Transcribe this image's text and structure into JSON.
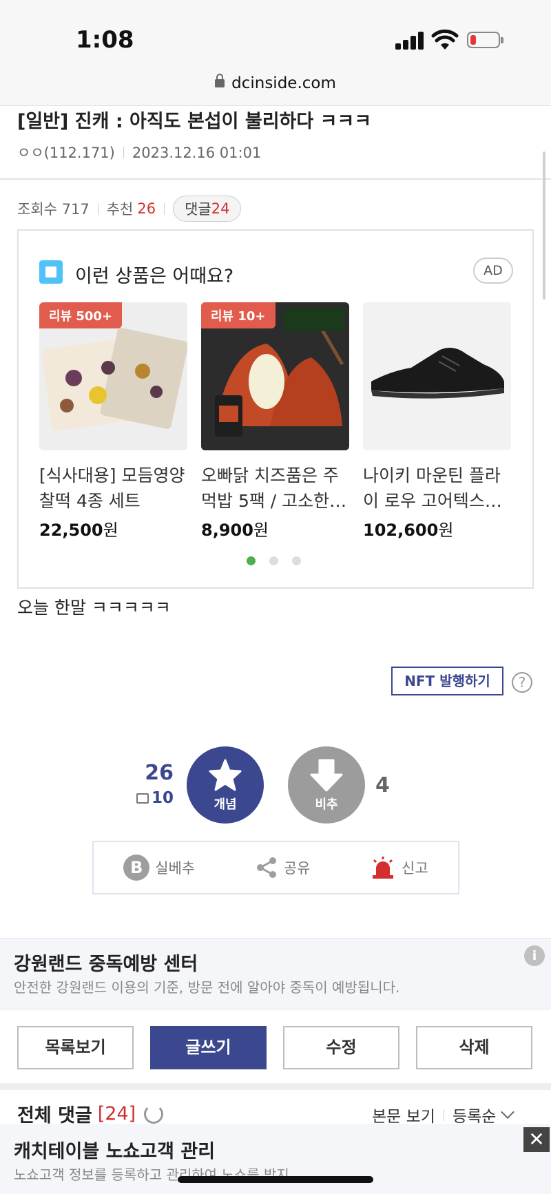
{
  "status": {
    "time": "1:08"
  },
  "browser": {
    "url": "dcinside.com"
  },
  "post": {
    "title": "[일반] 진캐 : 아직도 본섭이 불리하다 ㅋㅋㅋ",
    "author": "ㅇㅇ(112.171)",
    "date": "2023.12.16 01:01",
    "views_label": "조회수 717",
    "recommend_label": "추천",
    "recommend_count": "26",
    "comments_label": "댓글",
    "comments_count": "24",
    "body": "오늘 한말 ㅋㅋㅋㅋㅋ"
  },
  "ad": {
    "heading": "이런 상품은 어때요?",
    "badge": "AD",
    "products": [
      {
        "badge": "리뷰 500+",
        "title": "[식사대용] 모듬영양 찰떡 4종 세트",
        "price": "22,500",
        "unit": "원"
      },
      {
        "badge": "리뷰 10+",
        "title": "오빠닭 치즈품은 주먹밥 5팩 / 고소한…",
        "price": "8,900",
        "unit": "원"
      },
      {
        "badge": "",
        "title": "나이키 마운틴 플라이 로우 고어텍스…",
        "price": "102,600",
        "unit": "원"
      }
    ]
  },
  "nft": {
    "label": "NFT 발행하기",
    "help": "?"
  },
  "vote": {
    "up_count": "26",
    "fixed_count": "10",
    "up_label": "개념",
    "down_label": "비추",
    "down_count": "4"
  },
  "share": {
    "silbe": "실베추",
    "share": "공유",
    "report": "신고"
  },
  "promo": {
    "title": "강원랜드 중독예방 센터",
    "subtitle": "안전한 강원랜드 이용의 기준, 방문 전에 알아야 중독이 예방됩니다."
  },
  "actions": {
    "list": "목록보기",
    "write": "글쓰기",
    "edit": "수정",
    "delete": "삭제"
  },
  "comments": {
    "title": "전체 댓글",
    "count": "[24]",
    "view_body": "본문 보기",
    "sort": "등록순"
  },
  "bottom_ad": {
    "title": "캐치테이블 노쇼고객 관리",
    "subtitle": "노쇼고객 정보를 등록하고 관리하여 노쇼를 방지."
  },
  "colors": {
    "brand": "#3b4890",
    "accent_red": "#d32f2f",
    "review_badge": "#e25c4d"
  }
}
